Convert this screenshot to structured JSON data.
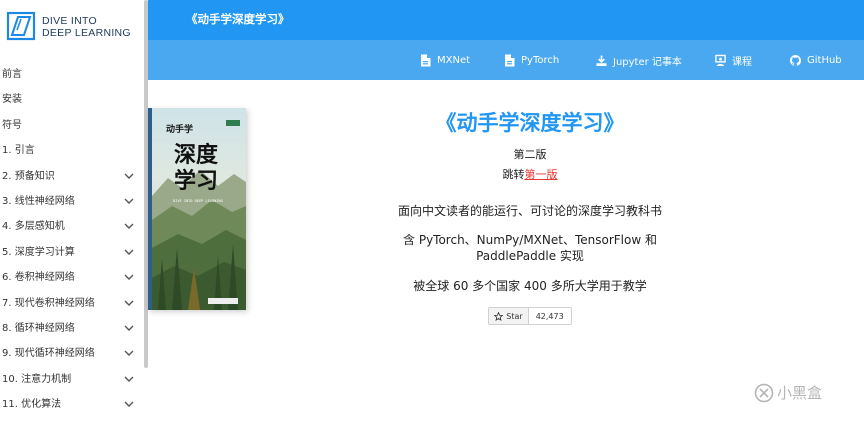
{
  "logo": {
    "line1": "DIVE INTO",
    "line2": "DEEP LEARNING"
  },
  "sidebar": {
    "items": [
      {
        "label": "前言",
        "expandable": false
      },
      {
        "label": "安装",
        "expandable": false
      },
      {
        "label": "符号",
        "expandable": false
      },
      {
        "label": "1. 引言",
        "expandable": false
      },
      {
        "label": "2. 预备知识",
        "expandable": true
      },
      {
        "label": "3. 线性神经网络",
        "expandable": true
      },
      {
        "label": "4. 多层感知机",
        "expandable": true
      },
      {
        "label": "5. 深度学习计算",
        "expandable": true
      },
      {
        "label": "6. 卷积神经网络",
        "expandable": true
      },
      {
        "label": "7. 现代卷积神经网络",
        "expandable": true
      },
      {
        "label": "8. 循环神经网络",
        "expandable": true
      },
      {
        "label": "9. 现代循环神经网络",
        "expandable": true
      },
      {
        "label": "10. 注意力机制",
        "expandable": true
      },
      {
        "label": "11. 优化算法",
        "expandable": true
      }
    ]
  },
  "header": {
    "title": "《动手学深度学习》"
  },
  "toolbar": {
    "mxnet": "MXNet",
    "pytorch": "PyTorch",
    "jupyter": "Jupyter 记事本",
    "course": "课程",
    "github": "GitHub"
  },
  "book": {
    "series_mark": "动手学",
    "title_line1": "深度",
    "title_line2": "学习",
    "dive_text": "DIVE INTO DEEP LEARNING"
  },
  "hero": {
    "title": "《动手学深度学习》",
    "edition": "第二版",
    "jump_prefix": "跳转",
    "jump_link": "第一版",
    "tagline": "面向中文读者的能运行、可讨论的深度学习教科书",
    "frameworks_line1": "含 PyTorch、NumPy/MXNet、TensorFlow 和",
    "frameworks_line2": "PaddlePaddle 实现",
    "usage": "被全球 60 多个国家 400 多所大学用于教学"
  },
  "github_star": {
    "label": "Star",
    "count": "42,473"
  },
  "watermark": "小黑盒",
  "colors": {
    "header": "#2196f3",
    "toolbar": "#4aa8f0",
    "accent": "#2196f3",
    "link": "#e53935"
  }
}
